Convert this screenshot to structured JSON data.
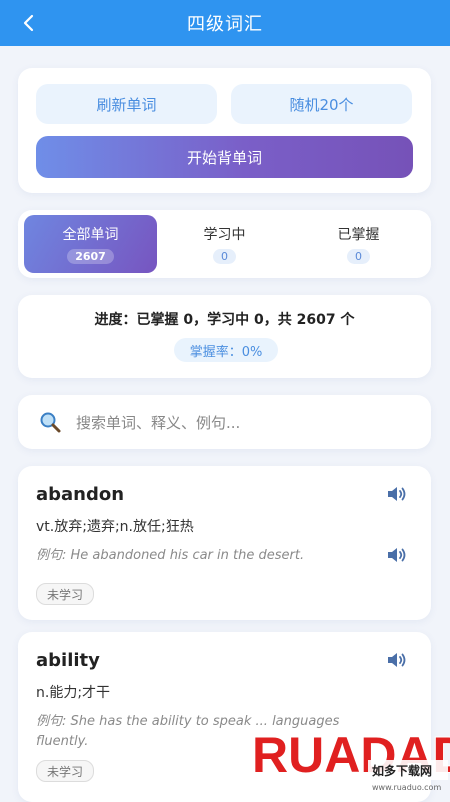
{
  "header": {
    "title": "四级词汇"
  },
  "actions": {
    "refresh_label": "刷新单词",
    "random_label": "随机20个",
    "start_label": "开始背单词"
  },
  "tabs": [
    {
      "label": "全部单词",
      "count": "2607"
    },
    {
      "label": "学习中",
      "count": "0"
    },
    {
      "label": "已掌握",
      "count": "0"
    }
  ],
  "progress": {
    "text": "进度：已掌握 0，学习中 0，共 2607 个",
    "rate": "掌握率：0%"
  },
  "search": {
    "placeholder": "搜索单词、释义、例句..."
  },
  "words": [
    {
      "word": "abandon",
      "meaning": "vt.放弃;遗弃;n.放任;狂热",
      "example_label": "例句:",
      "example": "He abandoned his car in the desert.",
      "status": "未学习"
    },
    {
      "word": "ability",
      "meaning": "n.能力;才干",
      "example_label": "例句:",
      "example": "She has the ability to speak ... languages fluently.",
      "status": "未学习"
    }
  ],
  "watermark": {
    "text": "RUADADO",
    "sub": "如多下载网",
    "url": "www.ruaduo.com"
  },
  "colors": {
    "header": "#2f94f0",
    "accent_purple": "#7652b8",
    "soft_blue": "#eaf3fd",
    "watermark_red": "#e02020"
  }
}
